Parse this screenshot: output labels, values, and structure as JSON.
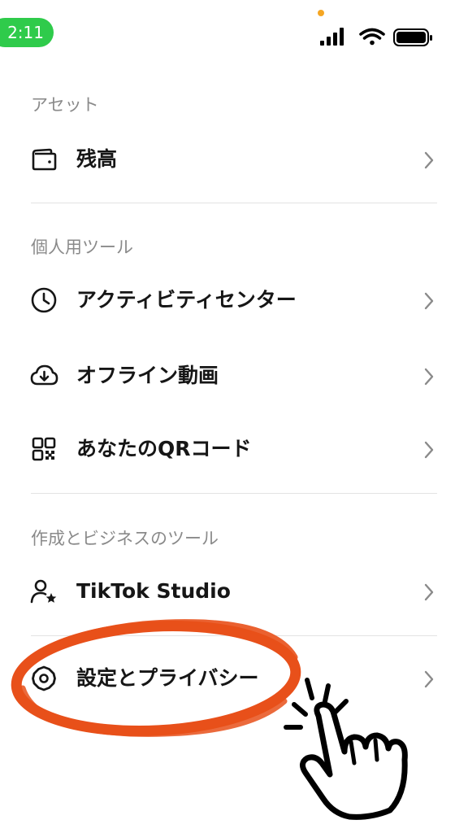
{
  "status_bar": {
    "time": "2:11",
    "icons": [
      "cellular-signal-icon",
      "wifi-icon",
      "battery-icon"
    ],
    "colors": {
      "time_pill": "#2fcb4b",
      "privacy_dot": "#f5a623"
    }
  },
  "sections": [
    {
      "title": "アセット",
      "items": [
        {
          "label": "残高",
          "icon": "wallet-icon"
        }
      ]
    },
    {
      "title": "個人用ツール",
      "items": [
        {
          "label": "アクティビティセンター",
          "icon": "clock-icon"
        },
        {
          "label": "オフライン動画",
          "icon": "cloud-download-icon"
        },
        {
          "label": "あなたのQRコード",
          "icon": "qr-code-icon"
        }
      ]
    },
    {
      "title": "作成とビジネスのツール",
      "items": [
        {
          "label": "TikTok Studio",
          "icon": "user-star-icon"
        },
        {
          "label": "設定とプライバシー",
          "icon": "gear-icon"
        }
      ]
    }
  ],
  "annotation": {
    "highlight_color": "#e8501a",
    "highlight_target": "設定とプライバシー",
    "icons": [
      "highlight-circle-icon",
      "tap-hand-icon"
    ]
  }
}
